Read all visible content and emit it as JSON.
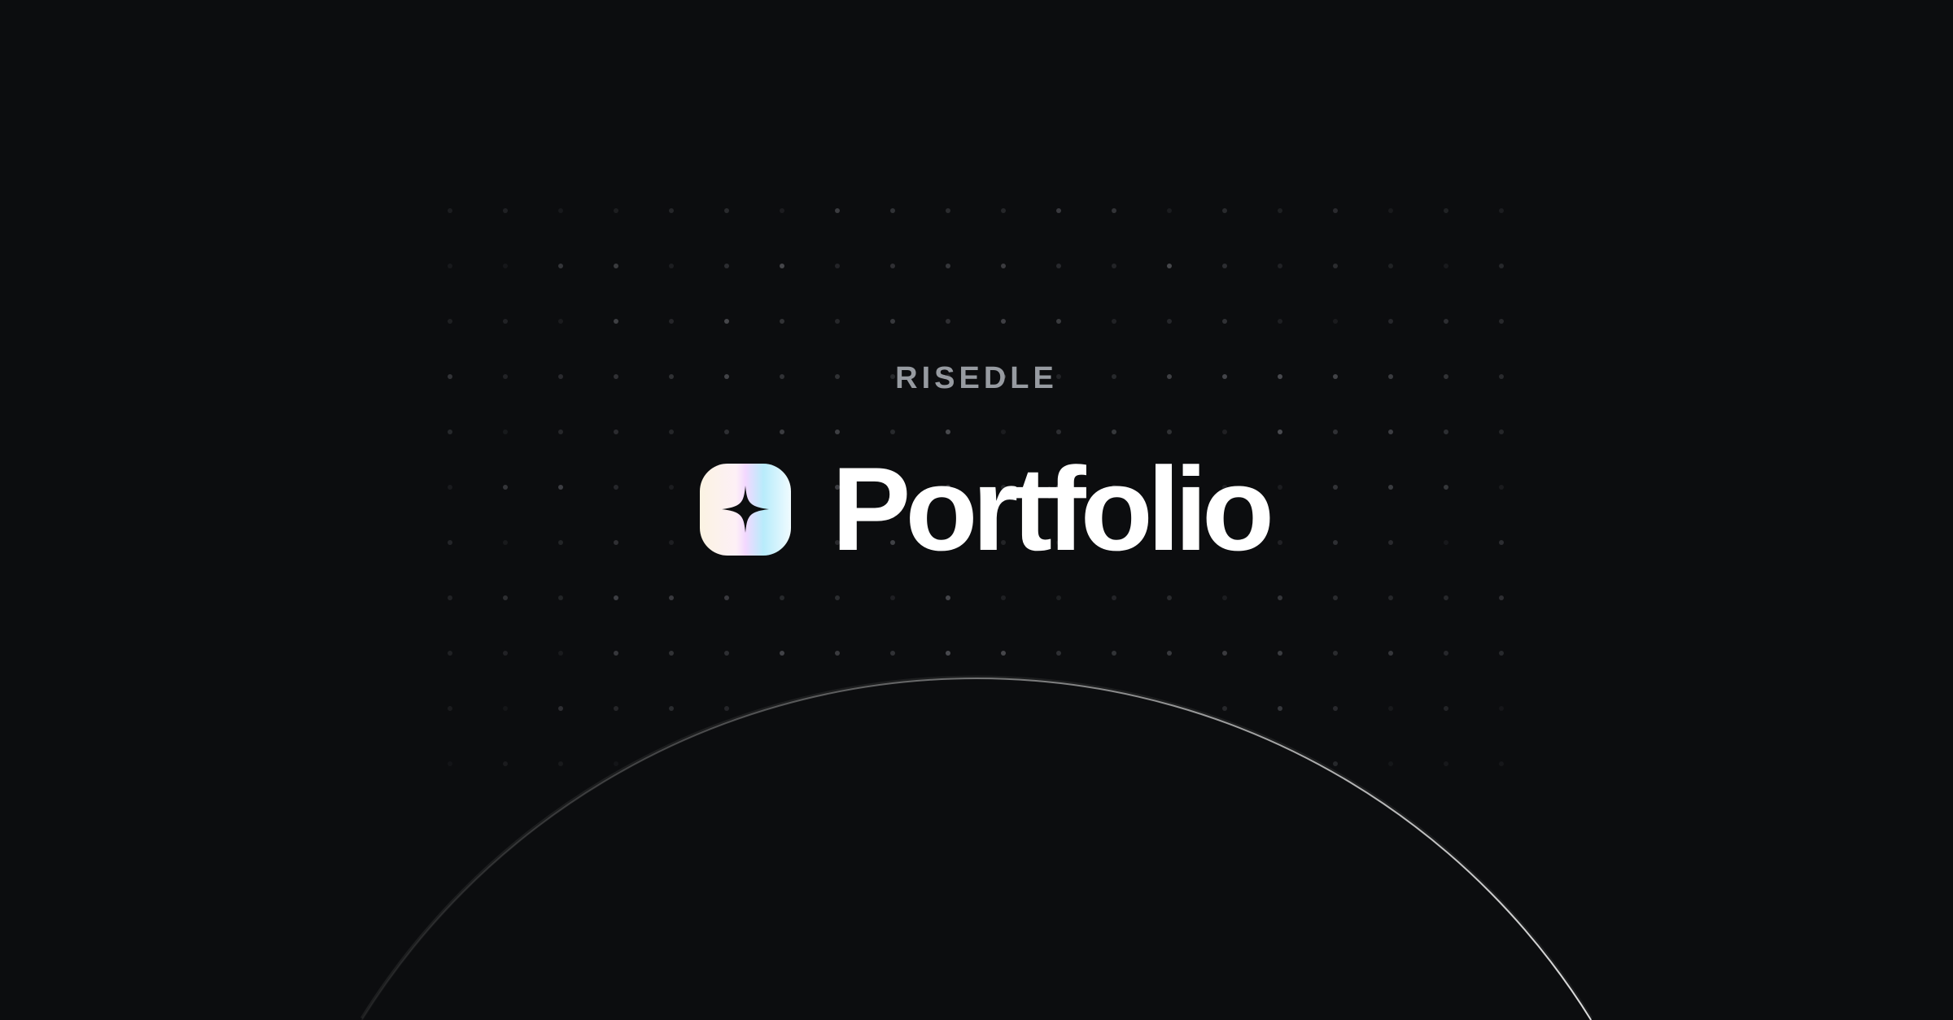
{
  "brand": {
    "name": "RISEDLE"
  },
  "hero": {
    "title": "Portfolio",
    "logo_icon": "sparkle-icon"
  },
  "colors": {
    "background": "#0c0d0f",
    "brand_text": "#979ba1",
    "title_text": "#ffffff",
    "dot": "#4a4b50"
  }
}
